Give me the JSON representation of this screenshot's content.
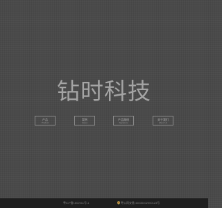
{
  "hero": {
    "title": "钻时科技"
  },
  "nav": {
    "items": [
      {
        "zh": "产品",
        "en": "Product"
      },
      {
        "zh": "案例",
        "en": "Cases"
      },
      {
        "zh": "产品路线",
        "en": "Signature"
      },
      {
        "zh": "关于我们",
        "en": "About Us"
      }
    ]
  },
  "footer": {
    "icp": "粤ICP备1602011号-1",
    "police": "粤公网安备 44030402000123号",
    "police_icon": "police-badge-icon",
    "background": "#1f1f1f"
  },
  "colors": {
    "background": "#4a4a4a",
    "title": "#a5a5a5",
    "button_border": "#8a8a8a"
  }
}
